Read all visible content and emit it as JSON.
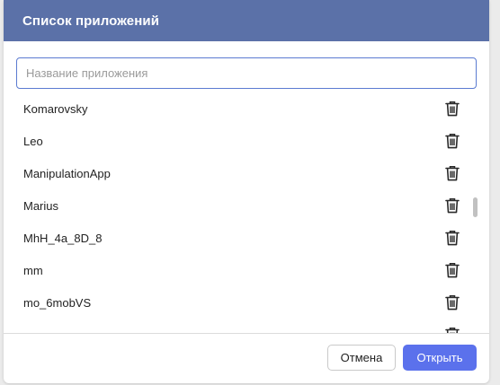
{
  "dialog": {
    "title": "Список приложений"
  },
  "search": {
    "placeholder": "Название приложения",
    "value": ""
  },
  "apps": [
    {
      "name": "Komarovsky",
      "action_icon": "trash-icon"
    },
    {
      "name": "Leo",
      "action_icon": "trash-icon"
    },
    {
      "name": "ManipulationApp",
      "action_icon": "trash-icon"
    },
    {
      "name": "Marius",
      "action_icon": "trash-icon"
    },
    {
      "name": "MhH_4a_8D_8",
      "action_icon": "trash-icon"
    },
    {
      "name": "mm",
      "action_icon": "trash-icon"
    },
    {
      "name": "mo_6mobVS",
      "action_icon": "trash-icon"
    },
    {
      "name": "",
      "action_icon": "trash-icon"
    }
  ],
  "footer": {
    "cancel_label": "Отмена",
    "open_label": "Открыть"
  },
  "colors": {
    "header_bg": "#5b71a8",
    "primary_button": "#5b71ec",
    "input_border": "#5b7bd1"
  }
}
